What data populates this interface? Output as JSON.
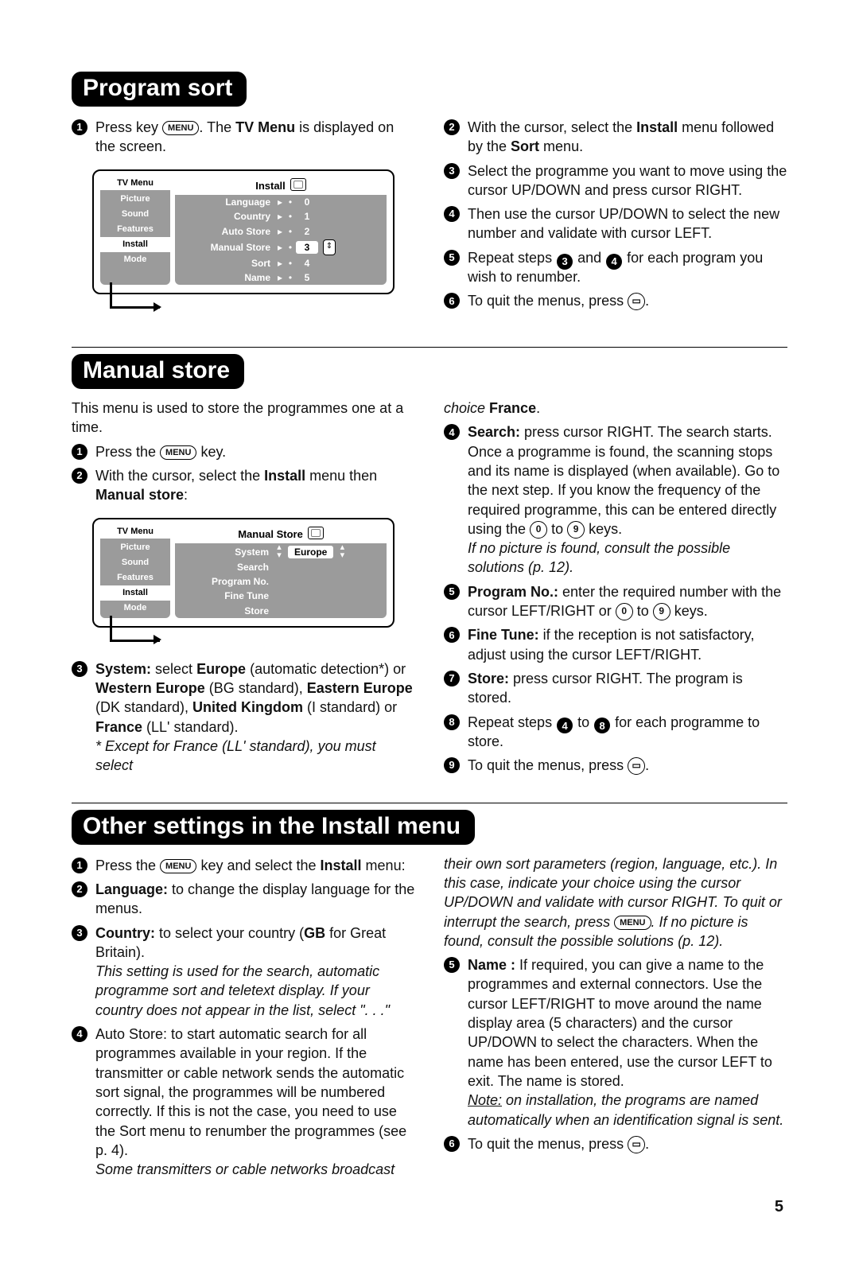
{
  "page_number": "5",
  "sections": {
    "sort": {
      "title": "Program sort",
      "left": {
        "s1_a": "Press key ",
        "s1_key": "MENU",
        "s1_b": ". The ",
        "s1_bold": "TV Menu",
        "s1_c": " is displayed on the screen."
      },
      "right": {
        "s2_a": "With the cursor, select the ",
        "s2_b": "Install",
        "s2_c": " menu followed by the ",
        "s2_d": "Sort",
        "s2_e": " menu.",
        "s3": "Select the programme you want to move using the cursor UP/DOWN and press cursor RIGHT.",
        "s4": "Then use the cursor UP/DOWN to select the new number and validate with cursor LEFT.",
        "s5_a": "Repeat steps ",
        "s5_b": " and ",
        "s5_c": " for each program you wish to renumber.",
        "s6_a": "To quit the menus, press ",
        "s6_key": "▭"
      },
      "tv": {
        "menu_hdr": "TV Menu",
        "items": [
          "Picture",
          "Sound",
          "Features",
          "Install",
          "Mode"
        ],
        "active_index": 3,
        "panel_hdr": "Install",
        "rows": [
          {
            "lab": "Language",
            "val": "0"
          },
          {
            "lab": "Country",
            "val": "1"
          },
          {
            "lab": "Auto Store",
            "val": "2"
          },
          {
            "lab": "Manual Store",
            "val": "3",
            "sel": true
          },
          {
            "lab": "Sort",
            "val": "4"
          },
          {
            "lab": "Name",
            "val": "5"
          }
        ]
      }
    },
    "manual": {
      "title": "Manual store",
      "intro": "This menu is used to store the programmes one at a time.",
      "left": {
        "s1_a": "Press the ",
        "s1_key": "MENU",
        "s1_b": " key.",
        "s2_a": "With the cursor, select the ",
        "s2_b": "Install",
        "s2_c": " menu then ",
        "s2_d": "Manual store",
        "s2_e": ":",
        "s3_a": "System:",
        "s3_b": " select ",
        "s3_c": "Europe",
        "s3_d": " (automatic detection*) or ",
        "s3_e": "Western Europe",
        "s3_f": " (BG standard), ",
        "s3_g": "Eastern Europe",
        "s3_h": " (DK standard), ",
        "s3_i": "United Kingdom",
        "s3_j": " (I standard) or ",
        "s3_k": "France",
        "s3_l": " (LL' standard).",
        "s3_note": "* Except for France (LL' standard), you must select"
      },
      "right": {
        "cont_a": "choice ",
        "cont_b": "France",
        "cont_c": ".",
        "s4_a": "Search:",
        "s4_b": " press cursor RIGHT. The search starts. Once a programme is found, the scanning stops and its name is displayed (when available). Go to the next step. If you know the frequency of the required programme, this can be entered directly using the ",
        "s4_k0": "0",
        "s4_mid": " to ",
        "s4_k9": "9",
        "s4_c": " keys.",
        "s4_note": "If no picture is found, consult the possible solutions (p. 12).",
        "s5_a": "Program No.:",
        "s5_b": " enter the required number with the cursor LEFT/RIGHT or ",
        "s5_k0": "0",
        "s5_mid": " to ",
        "s5_k9": "9",
        "s5_c": " keys.",
        "s6_a": "Fine Tune:",
        "s6_b": " if the reception is not satisfactory, adjust using the cursor LEFT/RIGHT.",
        "s7_a": "Store:",
        "s7_b": " press cursor RIGHT. The program is stored.",
        "s8_a": "Repeat steps ",
        "s8_b": " to ",
        "s8_c": " for each programme to store.",
        "s9_a": "To quit the menus, press ",
        "s9_key": "▭"
      },
      "tv": {
        "menu_hdr": "TV Menu",
        "items": [
          "Picture",
          "Sound",
          "Features",
          "Install",
          "Mode"
        ],
        "active_index": 3,
        "panel_hdr": "Manual Store",
        "rows": [
          {
            "lab": "System",
            "valw": "Europe",
            "sel": true
          },
          {
            "lab": "Search"
          },
          {
            "lab": "Program No."
          },
          {
            "lab": "Fine Tune"
          },
          {
            "lab": "Store"
          }
        ]
      }
    },
    "other": {
      "title": "Other settings in the Install menu",
      "left": {
        "s1_a": "Press the ",
        "s1_key": "MENU",
        "s1_b": " key and select the ",
        "s1_c": "Install",
        "s1_d": " menu:",
        "s2_a": "Language:",
        "s2_b": " to change the display language for the menus.",
        "s3_a": "Country:",
        "s3_b": " to select your country (",
        "s3_c": "GB",
        "s3_d": " for Great Britain).",
        "s3_note": "This setting is used for the search, automatic programme sort and teletext display. If your country does not appear in the list, select \". . .\"",
        "s4": "Auto Store: to start automatic search for all programmes available in your region. If the transmitter or cable network sends the automatic sort signal, the programmes will be numbered correctly. If this is not the case, you need to use the Sort menu to renumber the programmes (see p. 4).",
        "s4_note": "Some transmitters or cable networks broadcast"
      },
      "right": {
        "cont": "their own sort parameters (region, language, etc.). In this case, indicate your choice using the cursor UP/DOWN and validate with cursor RIGHT. To quit or interrupt the search, press ",
        "cont_key": "MENU",
        "cont_b": ". If no picture is found, consult the possible solutions (p. 12).",
        "s5_a": "Name :",
        "s5_b": " If required, you can give a name to the programmes and external connectors. Use the cursor LEFT/RIGHT to move around the name display area (5 characters) and the cursor UP/DOWN to select the characters. When the name has been entered, use the cursor LEFT to exit. The name is stored.",
        "s5_note": "Note: on installation, the programs are named automatically when an identification signal is sent.",
        "s6_a": "To quit the menus, press ",
        "s6_key": "▭"
      }
    }
  }
}
